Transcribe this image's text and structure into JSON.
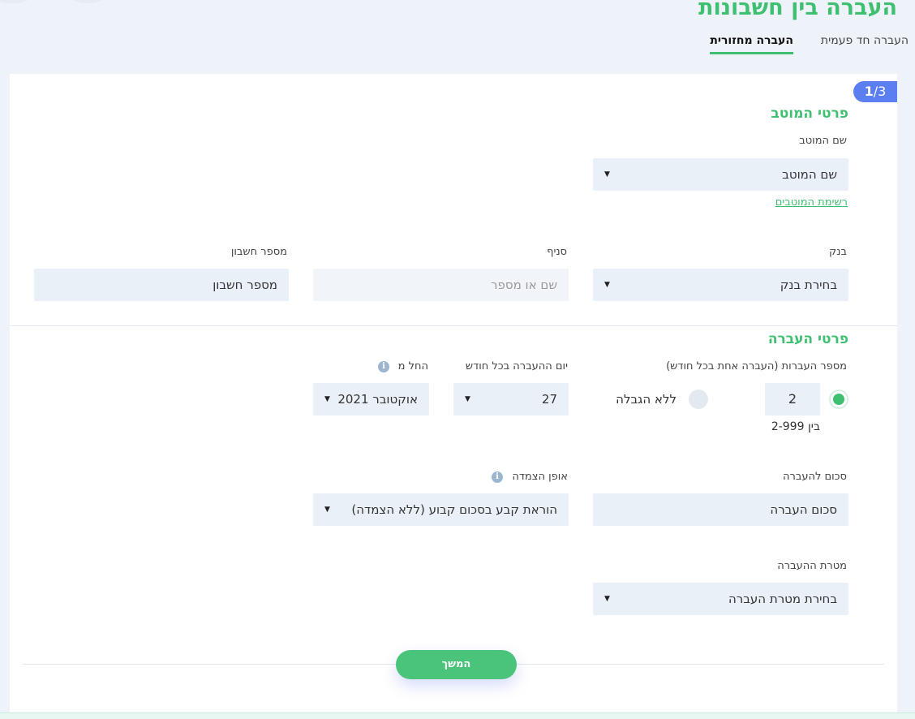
{
  "header": {
    "title": "העברה בין חשבונות",
    "tabs": [
      {
        "label": "העברה חד פעמית",
        "active": false
      },
      {
        "label": "העברה מחזורית",
        "active": true
      }
    ]
  },
  "step": {
    "current": "1",
    "total": "3",
    "separator": "/"
  },
  "beneficiary": {
    "section_title": "פרטי המוטב",
    "name_label": "שם המוטב",
    "name_value": "שם המוטב",
    "list_link": "רשימת המוטבים",
    "bank_label": "בנק",
    "bank_value": "בחירת בנק",
    "branch_label": "סניף",
    "branch_placeholder": "שם או מספר",
    "account_label": "מספר חשבון",
    "account_placeholder": "מספר חשבון"
  },
  "transfer": {
    "section_title": "פרטי העברה",
    "count_label": "מספר העברות (העברה אחת בכל חודש)",
    "count_value": "2",
    "count_range": "בין 2-999",
    "unlimited_label": "ללא הגבלה",
    "day_label": "יום ההעברה בכל חודש",
    "day_value": "27",
    "start_label": "החל מ",
    "start_value": "אוקטובר 2021",
    "amount_label": "סכום להעברה",
    "amount_placeholder": "סכום העברה",
    "linkage_label": "אופן הצמדה",
    "linkage_value": "הוראת קבע בסכום קבוע (ללא הצמדה)",
    "purpose_label": "מטרת ההעברה",
    "purpose_value": "בחירת מטרת העברה"
  },
  "actions": {
    "continue_label": "המשך"
  },
  "colors": {
    "accent": "#3fbf70",
    "badge": "#5b7ef0",
    "field_bg": "#eaf0f7"
  },
  "icons": {
    "info": "info-icon",
    "caret": "caret-down-icon"
  }
}
